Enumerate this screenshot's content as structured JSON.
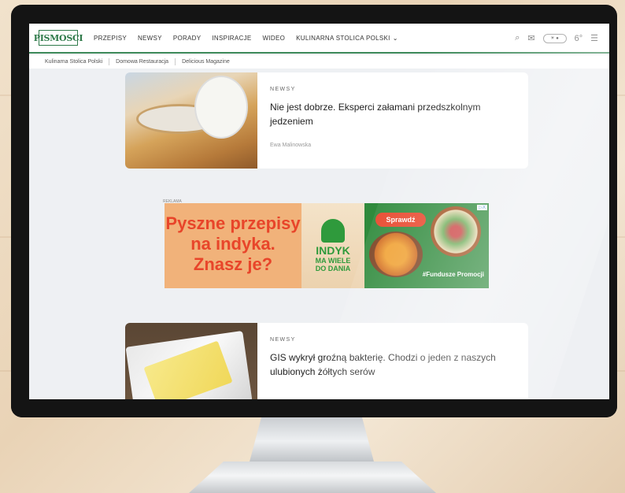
{
  "site": {
    "logo_text": "PISMOSCI"
  },
  "nav": {
    "items": [
      "PRZEPISY",
      "NEWSY",
      "PORADY",
      "INSPIRACJE",
      "WIDEO",
      "KULINARNA STOLICA POLSKI"
    ],
    "icons": [
      "search-icon",
      "mail-icon",
      "theme-toggle",
      "weather-icon",
      "menu-icon"
    ],
    "toggle_text": "☀ ●",
    "weather_text": "6°"
  },
  "subnav": {
    "items": [
      "Kulinarna Stolica Polski",
      "Domowa Restauracja",
      "Delicious Magazine"
    ]
  },
  "articles": [
    {
      "category": "NEWSY",
      "title": "Nie jest dobrze. Eksperci załamani przedszkolnym jedzeniem",
      "author": "Ewa Malinowska"
    },
    {
      "category": "NEWSY",
      "title": "GIS wykrył groźną bakterię. Chodzi o jeden z naszych ulubionych żółtych serów",
      "author": ""
    }
  ],
  "ad": {
    "label": "REKLAMA",
    "lines": [
      "Pyszne przepisy",
      "na indyka.",
      "Znasz je?"
    ],
    "brand_line1": "INDYK",
    "brand_line2": "MA WIELE",
    "brand_line3": "DO DANIA",
    "cta": "Sprawdź",
    "tag": "#Fundusze Promocji",
    "corner": "▷X"
  },
  "colors": {
    "brand_green": "#2f7a4a",
    "ad_orange": "#e8452a"
  }
}
